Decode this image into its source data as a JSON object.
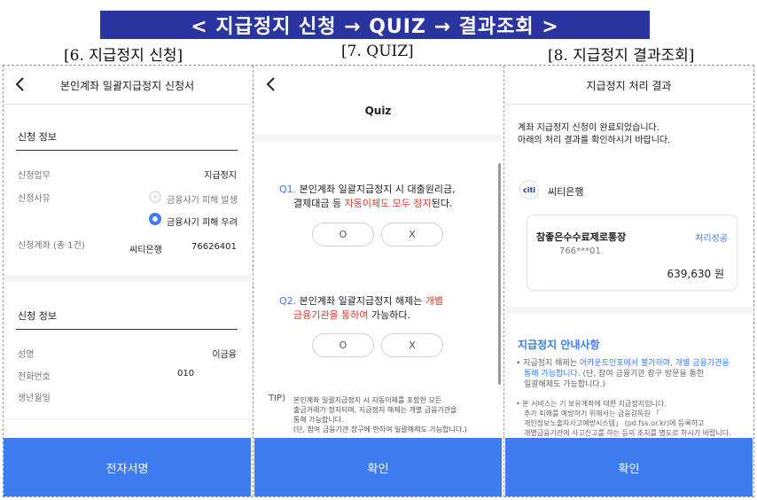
{
  "banner": "< 지급정지 신청 → QUIZ → 결과조회 >",
  "steps": [
    "[6. 지급정지 신청]",
    "[7. QUIZ]",
    "[8. 지급정지 결과조회]"
  ],
  "colors": {
    "banner": "#2b35a0",
    "accent": "#3e7cf0",
    "warning": "#e23a2e"
  },
  "icons": {
    "back": "chevron-left-icon",
    "bank": "citi-logo"
  },
  "p1": {
    "title": "본인계좌 일괄지급정지 신청서",
    "sec1": "신청 정보",
    "biz_label": "신청업무",
    "biz_value": "지급정지",
    "reason_label": "신청사유",
    "reason_opt1": "금융사기 피해 발생",
    "reason_opt2": "금융사기 피해 우려",
    "reason_selected": 2,
    "acct_label": "신청계좌 (총 1건)",
    "acct_bank": "씨티은행",
    "acct_no": "76626401",
    "sec2": "신청 정보",
    "name_label": "성명",
    "name_value": "이금융",
    "phone_label": "전화번호",
    "phone_value": "010",
    "birth_label": "생년월일",
    "button": "전자서명"
  },
  "p2": {
    "title": "Quiz",
    "q1_num": "Q1.",
    "q1_line1": "본인계좌 일괄지급정지 시 대출원리금,",
    "q1_line2_pre": "결제대금 등 ",
    "q1_line2_red": "자동이체도 모두 정지",
    "q1_line2_post": "된다.",
    "q2_num": "Q2.",
    "q2_line1_pre": "본인계좌 일괄지급정지 해제는 ",
    "q2_line1_red": "개별",
    "q2_line2_red": "금융기관을 통하여",
    "q2_line2_post": " 가능하다.",
    "o_label": "O",
    "x_label": "X",
    "tip_label": "TIP)",
    "tip_line1": "본인계좌 일괄지급정지 시 자동이체를 포함한 모든",
    "tip_line2": "출금거래가 정지되며, 지급정지 해제는 개별 금융기관을",
    "tip_line3": "통해 가능합니다.",
    "tip_line4": "(단, 참여 금융기관 창구에 한하여 일괄해제도 가능합니다.)",
    "button": "확인"
  },
  "p3": {
    "title": "지급정지 처리 결과",
    "intro1": "계좌 지급정지 신청이 완료되었습니다.",
    "intro2": "아래의 처리 결과를 확인하시기 바랍니다.",
    "logo_text": "citi",
    "bank": "씨티은행",
    "product": "참좋은수수료제로통장",
    "status": "처리성공",
    "acct": "766***01",
    "amount": "639,630 원",
    "guide_title": "지급정지 안내사항",
    "g1_pre": "지급정지 해제는 ",
    "g1_blue1": "어카운트인포에서 불가하며,",
    "g1_mid": " ",
    "g1_blue2": "개별 금융기관을",
    "g1_line2_blue": "통해 가능합니다.",
    "g1_line2_post": " (단, 참여 금융기관 창구 방문을 통한",
    "g1_line3": "일괄해제도 가능합니다.)",
    "g2_line1": "본 서비스는 기 보유계좌에 대한 지급정지입니다.",
    "g2_line2": "추가 피해를 예방하기 위해서는 금융감독원 「",
    "g2_line3": "개인정보노출자사고예방시스템」 (pd.fss.or.kr)에 등록하고",
    "g2_line4": "개별금융기관에 사고신고를 하는 등의 조치를 별도로 하시기 바랍니다.",
    "button": "확인"
  }
}
